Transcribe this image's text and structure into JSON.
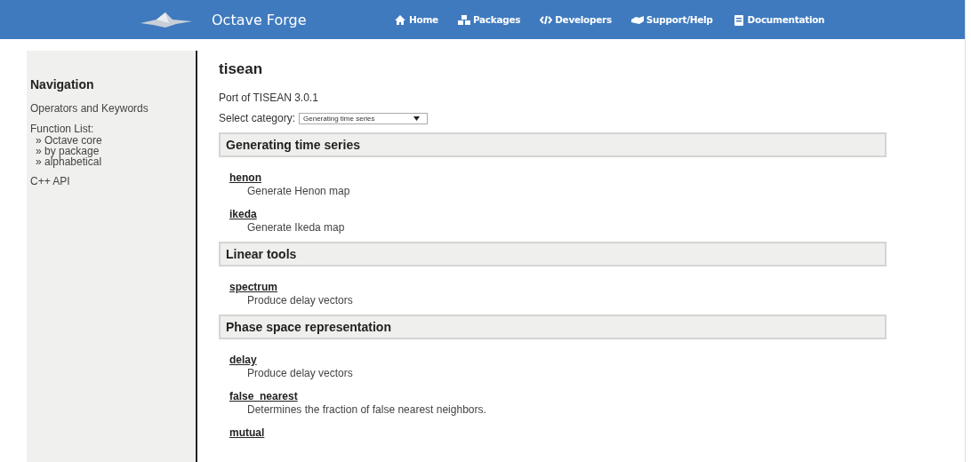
{
  "header": {
    "title": "Octave Forge",
    "nav": [
      {
        "kind": "home",
        "label": "Home"
      },
      {
        "kind": "packages",
        "label": "Packages"
      },
      {
        "kind": "code",
        "label": "Developers"
      },
      {
        "kind": "support",
        "label": "Support/Help"
      },
      {
        "kind": "book",
        "label": "Documentation"
      }
    ]
  },
  "sidebar": {
    "title": "Navigation",
    "items": [
      {
        "label": "Operators and Keywords"
      },
      {
        "label": "Function List:",
        "children": [
          {
            "label": "» Octave core"
          },
          {
            "label": "» by package"
          },
          {
            "label": "» alphabetical"
          }
        ]
      },
      {
        "label": "C++ API"
      }
    ]
  },
  "page": {
    "title": "tisean",
    "description": "Port of TISEAN 3.0.1",
    "select": {
      "label": "Select category:",
      "value": "Generating time series"
    },
    "sections": [
      {
        "title": "Generating time series",
        "functions": [
          {
            "name": "henon",
            "description": "Generate Henon map"
          },
          {
            "name": "ikeda",
            "description": "Generate Ikeda map"
          }
        ]
      },
      {
        "title": "Linear tools",
        "functions": [
          {
            "name": "spectrum",
            "description": "Produce delay vectors"
          }
        ]
      },
      {
        "title": "Phase space representation",
        "functions": [
          {
            "name": "delay",
            "description": "Produce delay vectors"
          },
          {
            "name": "false_nearest",
            "description": "Determines the fraction of false nearest neighbors."
          },
          {
            "name": "mutual"
          }
        ]
      }
    ]
  }
}
